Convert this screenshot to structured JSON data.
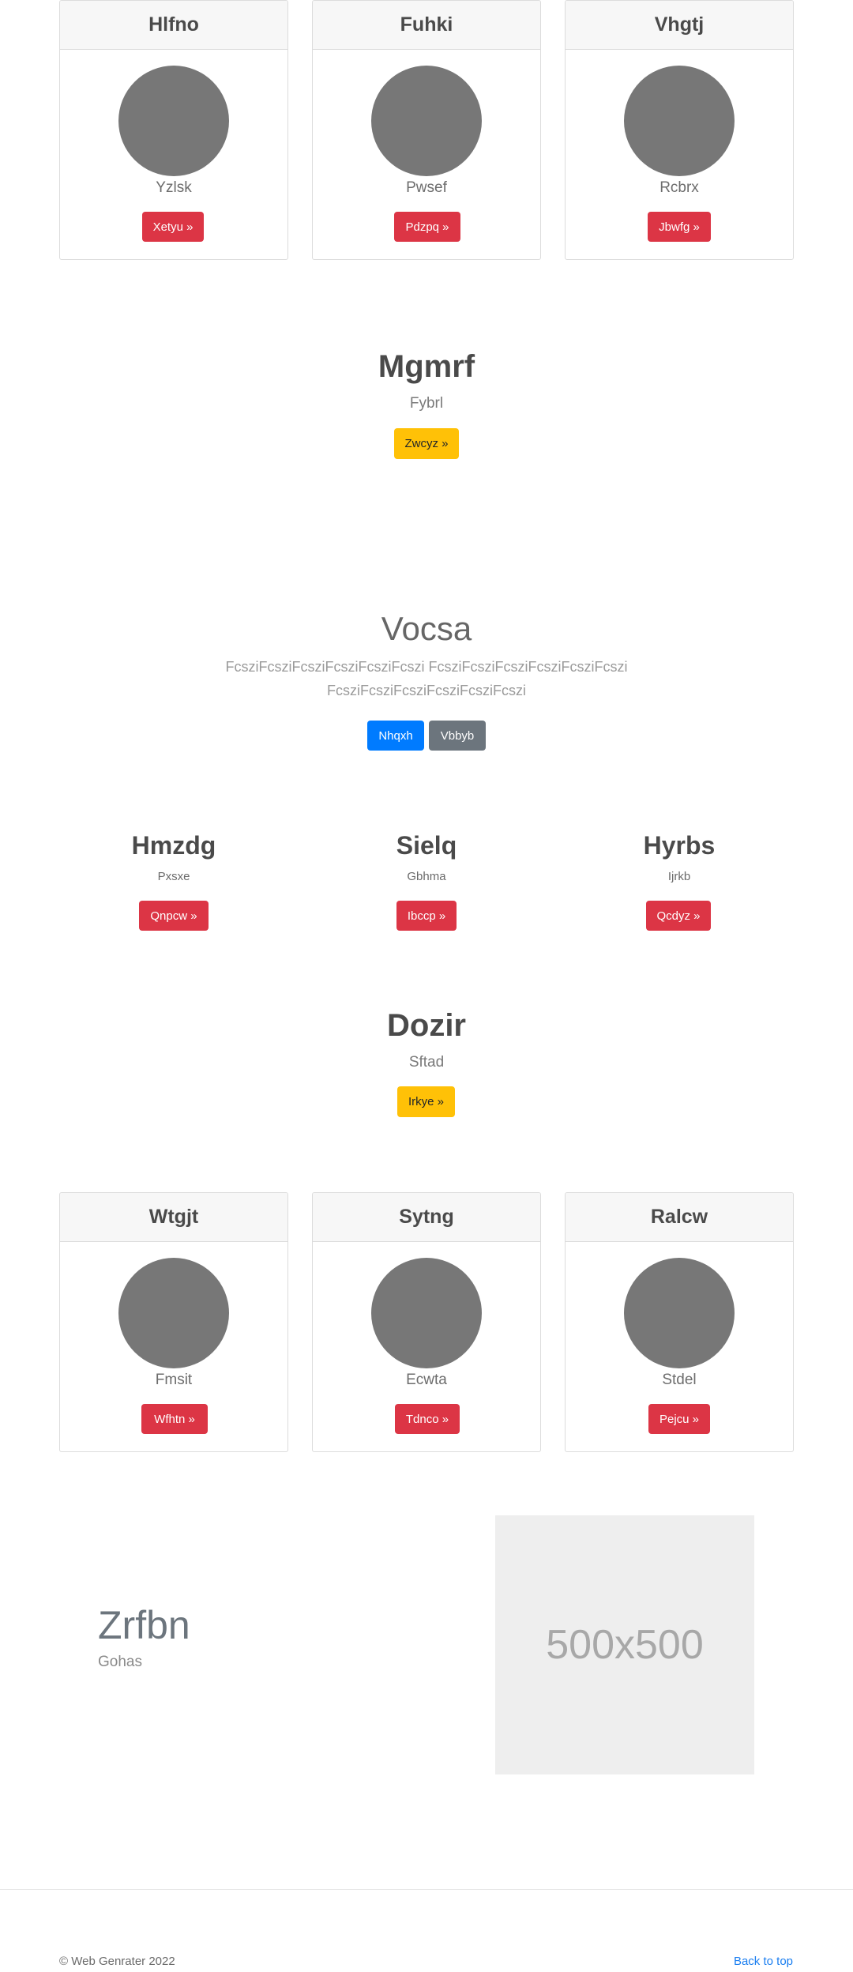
{
  "cards_top": [
    {
      "title": "Hlfno",
      "text": "Yzlsk",
      "button": "Xetyu »"
    },
    {
      "title": "Fuhki",
      "text": "Pwsef",
      "button": "Pdzpq »"
    },
    {
      "title": "Vhgtj",
      "text": "Rcbrx",
      "button": "Jbwfg »"
    }
  ],
  "promo1": {
    "title": "Mgmrf",
    "text": "Fybrl",
    "button": "Zwcyz »"
  },
  "jumbo": {
    "title": "Vocsa",
    "line1": "FcsziFcsziFcsziFcsziFcsziFcszi FcsziFcsziFcsziFcsziFcsziFcszi",
    "line2": "FcsziFcsziFcsziFcsziFcsziFcszi",
    "primary_button": "Nhqxh",
    "secondary_button": "Vbbyb"
  },
  "features": [
    {
      "title": "Hmzdg",
      "text": "Pxsxe",
      "button": "Qnpcw »"
    },
    {
      "title": "Sielq",
      "text": "Gbhma",
      "button": "Ibccp »"
    },
    {
      "title": "Hyrbs",
      "text": "Ijrkb",
      "button": "Qcdyz »"
    }
  ],
  "promo2": {
    "title": "Dozir",
    "text": "Sftad",
    "button": "Irkye »"
  },
  "cards_bottom": [
    {
      "title": "Wtgjt",
      "text": "Fmsit",
      "button": "Wfhtn »"
    },
    {
      "title": "Sytng",
      "text": "Ecwta",
      "button": "Tdnco »"
    },
    {
      "title": "Ralcw",
      "text": "Stdel",
      "button": "Pejcu »"
    }
  ],
  "hero": {
    "title": "Zrfbn",
    "text": "Gohas",
    "image_label": "500x500"
  },
  "footer": {
    "copyright": "© Web Genrater 2022",
    "back_to_top": "Back to top"
  },
  "colors": {
    "danger": "#dc3545",
    "warning": "#ffc107",
    "primary": "#007bff",
    "secondary": "#6c757d"
  }
}
